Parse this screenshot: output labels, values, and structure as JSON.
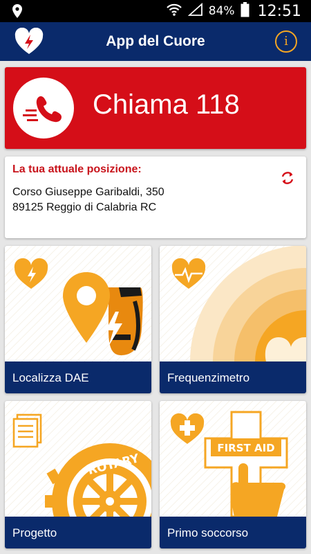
{
  "status_bar": {
    "battery_percent": "84%",
    "time": "12:51"
  },
  "app_bar": {
    "title": "App del Cuore",
    "info_icon": "info-icon"
  },
  "call_button": {
    "label": "Chiama 118",
    "icon": "phone-icon"
  },
  "position": {
    "heading": "La tua attuale posizione:",
    "address_line1": "Corso Giuseppe Garibaldi, 350",
    "address_line2": "89125 Reggio di Calabria RC"
  },
  "tiles": [
    {
      "label": "Localizza DAE",
      "icon": "heart-bolt-icon"
    },
    {
      "label": "Frequenzimetro",
      "icon": "heart-pulse-icon"
    },
    {
      "label": "Progetto",
      "icon": "documents-icon",
      "art_text": "ROTARY"
    },
    {
      "label": "Primo soccorso",
      "icon": "heart-plus-icon",
      "art_text": "FIRST AID"
    }
  ],
  "colors": {
    "navy": "#0a2a6b",
    "red": "#d50e18",
    "orange": "#f5a623",
    "dark_orange": "#e8890f"
  }
}
